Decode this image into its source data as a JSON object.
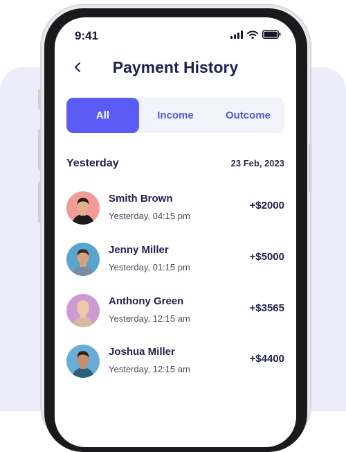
{
  "status_bar": {
    "time": "9:41"
  },
  "header": {
    "title": "Payment History"
  },
  "tabs": [
    {
      "label": "All",
      "active": true
    },
    {
      "label": "Income",
      "active": false
    },
    {
      "label": "Outcome",
      "active": false
    }
  ],
  "section": {
    "label": "Yesterday",
    "date": "23 Feb, 2023"
  },
  "transactions": [
    {
      "name": "Smith Brown",
      "time": "Yesterday, 04:15 pm",
      "amount": "+$2000",
      "avatar_bg": "#f29c97",
      "skin": "#e3b08d",
      "hair": "#2a1c16",
      "shirt": "#1c1c1c"
    },
    {
      "name": "Jenny Miller",
      "time": "Yesterday, 01:15 pm",
      "amount": "+$5000",
      "avatar_bg": "#5aa5cf",
      "skin": "#d9a07d",
      "hair": "#3a2a20",
      "shirt": "#7a8da0"
    },
    {
      "name": "Anthony Green",
      "time": "Yesterday, 12:15 am",
      "amount": "+$3565",
      "avatar_bg": "#cf9ad4",
      "skin": "#f0c9a8",
      "hair": "#e8cf9a",
      "shirt": "#d9b8a3"
    },
    {
      "name": "Joshua Miller",
      "time": "Yesterday, 12:15 am",
      "amount": "+$4400",
      "avatar_bg": "#6aaed6",
      "skin": "#c98d68",
      "hair": "#2b1e18",
      "shirt": "#2d5f7d"
    }
  ],
  "colors": {
    "accent": "#5b5cf6",
    "title": "#1f1f4d",
    "tab_bg": "#f2f2fb",
    "backdrop": "#ececfb"
  }
}
